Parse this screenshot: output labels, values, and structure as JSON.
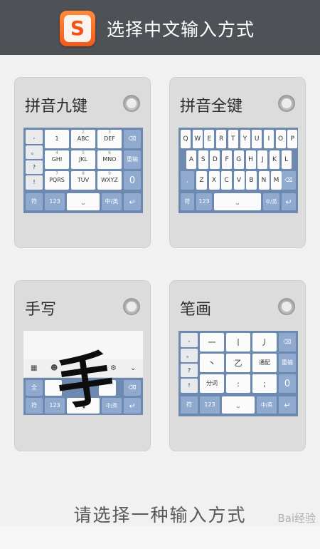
{
  "header": {
    "title": "选择中文输入方式",
    "logo_letter": "S"
  },
  "options": [
    {
      "title": "拼音九键",
      "selected": false
    },
    {
      "title": "拼音全键",
      "selected": false
    },
    {
      "title": "手写",
      "selected": false
    },
    {
      "title": "笔画",
      "selected": false
    }
  ],
  "keyboards": {
    "nine": {
      "rows": [
        [
          "1",
          "ABC",
          "DEF"
        ],
        [
          "GHI",
          "JKL",
          "MNO"
        ],
        [
          "PQRS",
          "TUV",
          "WXYZ"
        ]
      ],
      "sups": [
        [
          "",
          "2",
          "3"
        ],
        [
          "4",
          "5",
          "6"
        ],
        [
          "7",
          "8",
          "9"
        ]
      ],
      "left_col": [
        ",",
        "。",
        "?",
        "!"
      ],
      "right_keys": [
        "重输",
        "0"
      ],
      "bottom": [
        "符",
        "123",
        "中/英"
      ]
    },
    "full": {
      "row1": [
        "Q",
        "W",
        "E",
        "R",
        "T",
        "Y",
        "U",
        "I",
        "O",
        "P"
      ],
      "row2": [
        "A",
        "S",
        "D",
        "F",
        "G",
        "H",
        "J",
        "K",
        "L"
      ],
      "row3": [
        "Z",
        "X",
        "C",
        "V",
        "B",
        "N",
        "M"
      ],
      "row3_left": ",",
      "bottom": [
        "符",
        "123",
        "中/英"
      ]
    },
    "handwriting": {
      "glyph": "手",
      "left_key": "全",
      "bottom": [
        "符",
        "123",
        "中/英"
      ]
    },
    "stroke": {
      "rows": [
        [
          "一",
          "丨",
          "丿"
        ],
        [
          "丶",
          "乙",
          "通配"
        ],
        [
          "分词",
          ":",
          ";"
        ]
      ],
      "left_col": [
        ",",
        "。",
        "?",
        "!"
      ],
      "right_keys": [
        "重输",
        "0"
      ],
      "bottom": [
        "符",
        "123",
        "中/英"
      ]
    }
  },
  "footer": {
    "prompt": "请选择一种输入方式",
    "watermark": "Bai经验"
  }
}
